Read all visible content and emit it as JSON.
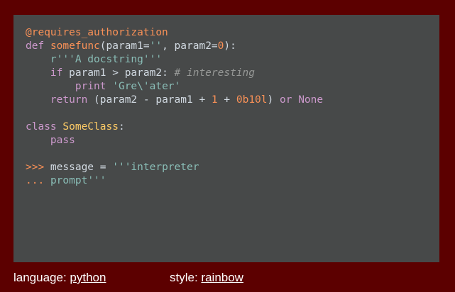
{
  "code_lines": [
    [
      {
        "t": "@requires_authorization",
        "c": "decorator"
      }
    ],
    [
      {
        "t": "def",
        "c": "keyword"
      },
      {
        "t": " ",
        "c": "plain"
      },
      {
        "t": "somefunc",
        "c": "funcname"
      },
      {
        "t": "(param1=",
        "c": "plain"
      },
      {
        "t": "''",
        "c": "string"
      },
      {
        "t": ", param2=",
        "c": "plain"
      },
      {
        "t": "0",
        "c": "number"
      },
      {
        "t": "):",
        "c": "plain"
      }
    ],
    [
      {
        "t": "    ",
        "c": "plain"
      },
      {
        "t": "r'''A docstring'''",
        "c": "string"
      }
    ],
    [
      {
        "t": "    ",
        "c": "plain"
      },
      {
        "t": "if",
        "c": "keyword"
      },
      {
        "t": " param1 > param2: ",
        "c": "plain"
      },
      {
        "t": "# interesting",
        "c": "comment"
      }
    ],
    [
      {
        "t": "        ",
        "c": "plain"
      },
      {
        "t": "print",
        "c": "keyword"
      },
      {
        "t": " ",
        "c": "plain"
      },
      {
        "t": "'Gre\\'ater'",
        "c": "string"
      }
    ],
    [
      {
        "t": "    ",
        "c": "plain"
      },
      {
        "t": "return",
        "c": "keyword"
      },
      {
        "t": " (param2 - param1 + ",
        "c": "plain"
      },
      {
        "t": "1",
        "c": "number"
      },
      {
        "t": " + ",
        "c": "plain"
      },
      {
        "t": "0b10l",
        "c": "number"
      },
      {
        "t": ") ",
        "c": "plain"
      },
      {
        "t": "or",
        "c": "keyword"
      },
      {
        "t": " ",
        "c": "plain"
      },
      {
        "t": "None",
        "c": "keyword"
      }
    ],
    [],
    [
      {
        "t": "class",
        "c": "keyword"
      },
      {
        "t": " ",
        "c": "plain"
      },
      {
        "t": "SomeClass",
        "c": "classname"
      },
      {
        "t": ":",
        "c": "plain"
      }
    ],
    [
      {
        "t": "    ",
        "c": "plain"
      },
      {
        "t": "pass",
        "c": "keyword"
      }
    ],
    [],
    [
      {
        "t": ">>>",
        "c": "prompt"
      },
      {
        "t": " message = ",
        "c": "plain"
      },
      {
        "t": "'''interpreter",
        "c": "string"
      }
    ],
    [
      {
        "t": "...",
        "c": "prompt"
      },
      {
        "t": " ",
        "c": "plain"
      },
      {
        "t": "prompt'''",
        "c": "string"
      }
    ]
  ],
  "footer": {
    "language_label": "language:",
    "language_value": "python",
    "style_label": "style:",
    "style_value": "rainbow"
  },
  "colors": {
    "background": "#5c0000",
    "code_background": "#474949",
    "decorator": "#f99157",
    "keyword": "#cc99cc",
    "funcname": "#f99157",
    "string": "#8abeb7",
    "number": "#f99157",
    "comment": "#969896",
    "classname": "#ffcc66",
    "plain": "#d1d9e1"
  }
}
